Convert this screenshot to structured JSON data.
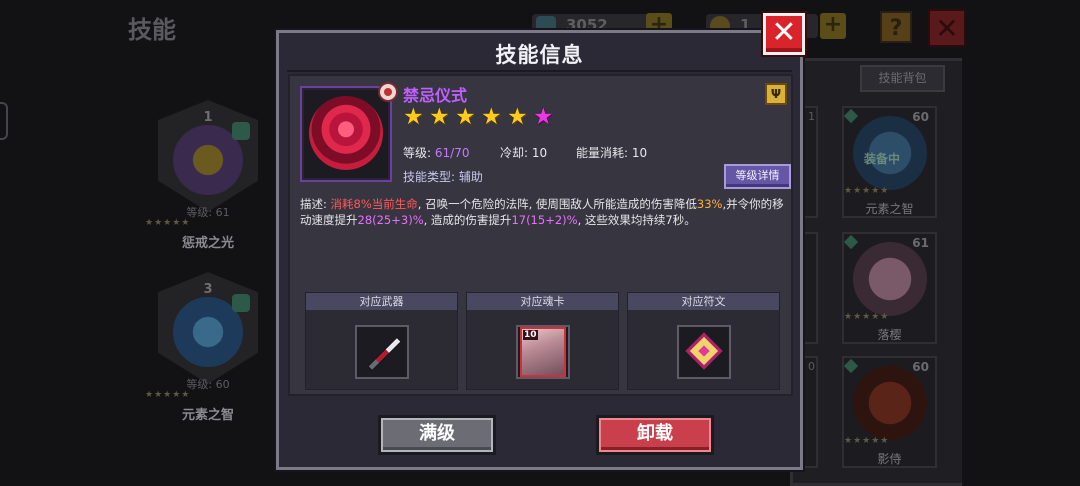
{
  "background": {
    "screen_title": "技能",
    "currency_1": "3052",
    "currency_2": "1",
    "help_icon": "?",
    "close_icon": "✕",
    "bag_button": "技能背包",
    "equipped_slots": [
      {
        "slot": "1",
        "level": "等级: 61",
        "stars": "★★★★★",
        "name": "惩戒之光"
      },
      {
        "slot": "3",
        "level": "等级: 60",
        "stars": "★★★★★",
        "name": "元素之智"
      }
    ],
    "bag_cards": [
      {
        "level": "60",
        "tag": "装备中",
        "stars": "★★★★★",
        "name": "元素之智"
      },
      {
        "level": "61",
        "tag": "",
        "stars": "★★★★★",
        "name": "落樱"
      },
      {
        "level": "60",
        "tag": "",
        "stars": "★★★★★",
        "name": "影侍"
      }
    ],
    "partial_levels": [
      "1",
      "0"
    ]
  },
  "modal": {
    "title": "技能信息",
    "close_label": "✕",
    "skill": {
      "name": "禁忌仪式",
      "stars": 6,
      "star_glyph": "★",
      "level_label": "等级:",
      "level_value": "61/70",
      "cooldown_label": "冷却:",
      "cooldown_value": "10",
      "cost_label": "能量消耗:",
      "cost_value": "10",
      "type_label": "技能类型:",
      "type_value": "辅助",
      "detail_button": "等级详情",
      "corner_icon": "Ψ"
    },
    "description": {
      "p1": "描述: ",
      "p2": "消耗8%当前生命",
      "p3": ", 召唤一个危险的法阵, 使周围敌人所能造成的伤害降低",
      "p4": "33%",
      "p5": ",并令你的移动速度提升",
      "p6": "28(25+3)%",
      "p7": ", 造成的伤害提升",
      "p8": "17(15+2)%",
      "p9": ", 这些效果均持续7秒。"
    },
    "related": [
      {
        "header": "对应武器"
      },
      {
        "header": "对应魂卡",
        "card_number": "10"
      },
      {
        "header": "对应符文"
      }
    ],
    "buttons": {
      "max_level": "满级",
      "unload": "卸载"
    }
  },
  "colors": {
    "skill_name": "#c060ff",
    "highlight_red": "#ff5a5a",
    "highlight_orange": "#ffb03a",
    "highlight_pink": "#e870ff",
    "star_gold": "#ffcc1e",
    "star_pink": "#ee38e4",
    "close_red": "#d8242a"
  }
}
